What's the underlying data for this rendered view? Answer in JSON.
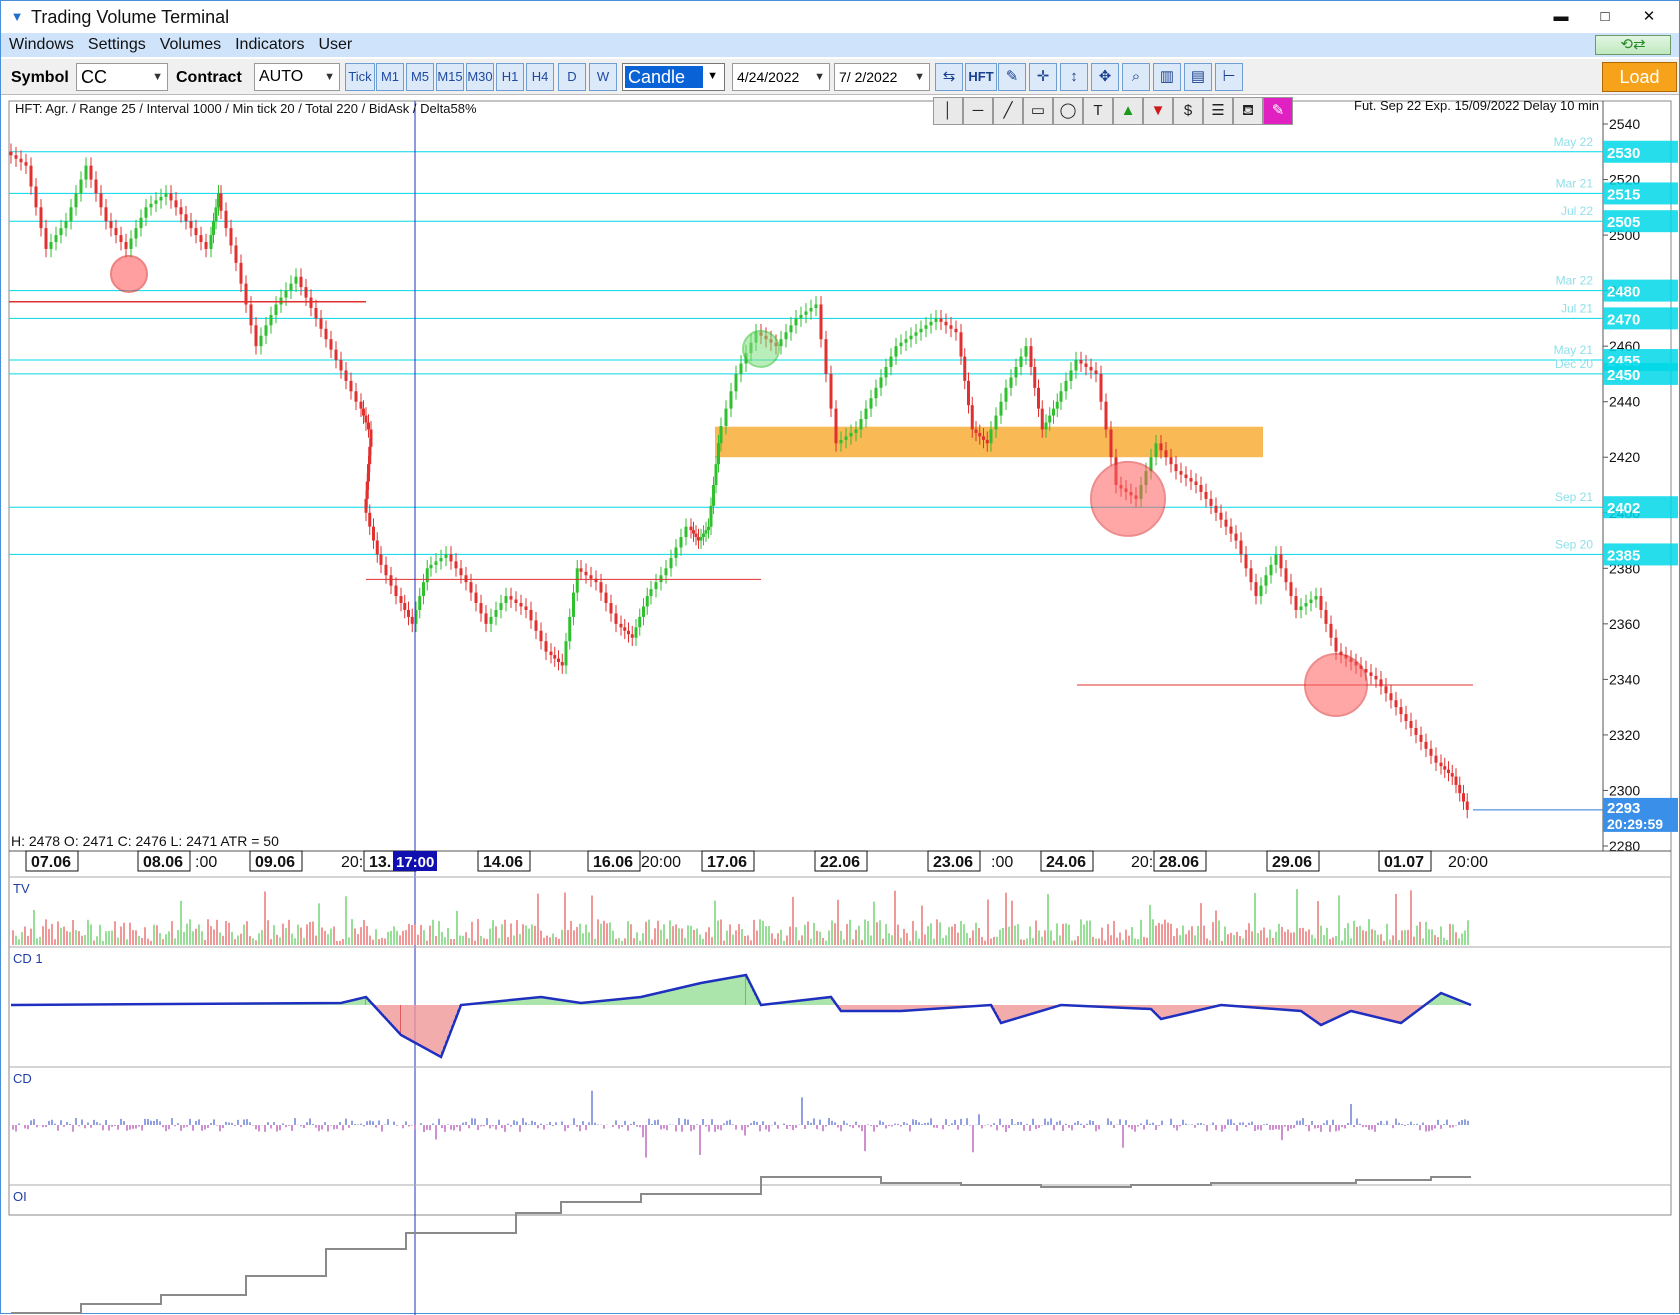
{
  "window": {
    "title": "Trading Volume Terminal",
    "minimize": "▬",
    "maximize": "□",
    "close": "✕"
  },
  "menu": {
    "items": [
      "Windows",
      "Settings",
      "Volumes",
      "Indicators",
      "User"
    ],
    "refresh_icon": "refresh-icon"
  },
  "toolbar": {
    "symbol_label": "Symbol",
    "symbol_value": "CC",
    "contract_label": "Contract",
    "contract_value": "AUTO",
    "timeframes": [
      "Tick",
      "M1",
      "M5",
      "M15",
      "M30",
      "H1",
      "H4",
      "D",
      "W"
    ],
    "chart_type": "Candle",
    "date_from": "4/24/2022",
    "date_to": "7/ 2/2022",
    "hft_label": "HFT",
    "load_label": "Load"
  },
  "chart": {
    "info_left": "HFT: Agr. / Range 25 / Interval 1000 / Min tick 20 / Total 220 / BidAsk / Delta58%",
    "info_right": "Fut. Sep 22 Exp. 15/09/2022 Delay 10 min",
    "ohlc": "H: 2478  O: 2471  C: 2476  L: 2471  ATR = 50",
    "price_ticks": [
      "2540",
      "2520",
      "2500",
      "2480",
      "2460",
      "2440",
      "2420",
      "2400",
      "2380",
      "2360",
      "2340",
      "2320",
      "2300",
      "2280"
    ],
    "level_tags": [
      {
        "price": "2530",
        "label": "May 22"
      },
      {
        "price": "2515",
        "label": "Mar 21"
      },
      {
        "price": "2505",
        "label": "Jul 22"
      },
      {
        "price": "2480",
        "label": "Mar 22"
      },
      {
        "price": "2470",
        "label": "Jul 21"
      },
      {
        "price": "2455",
        "label": "May 21"
      },
      {
        "price": "2450",
        "label": "Dec 20"
      },
      {
        "price": "2402",
        "label": "Sep 21"
      },
      {
        "price": "2385",
        "label": "Sep 20"
      }
    ],
    "last_price": "2293",
    "last_time": "20:29:59",
    "date_labels": [
      "07.06",
      "08.06",
      "09.06",
      "13.",
      "14.06",
      "16.06",
      "17.06",
      "22.06",
      "23.06",
      "24.06",
      "28.06",
      "29.06",
      "01.07"
    ],
    "time_labels": [
      ":00",
      "20:",
      "20:00",
      ":00",
      "20:",
      "20:00"
    ],
    "cursor_time": "17:00",
    "panes": [
      "TV",
      "CD 1",
      "CD",
      "OI"
    ]
  },
  "colors": {
    "bull": "#2fbf2f",
    "bear": "#e03030",
    "level": "#00d8e8",
    "zone": "#f7a21b",
    "cd_line": "#1f2fbf",
    "cursor": "#2030c0"
  }
}
